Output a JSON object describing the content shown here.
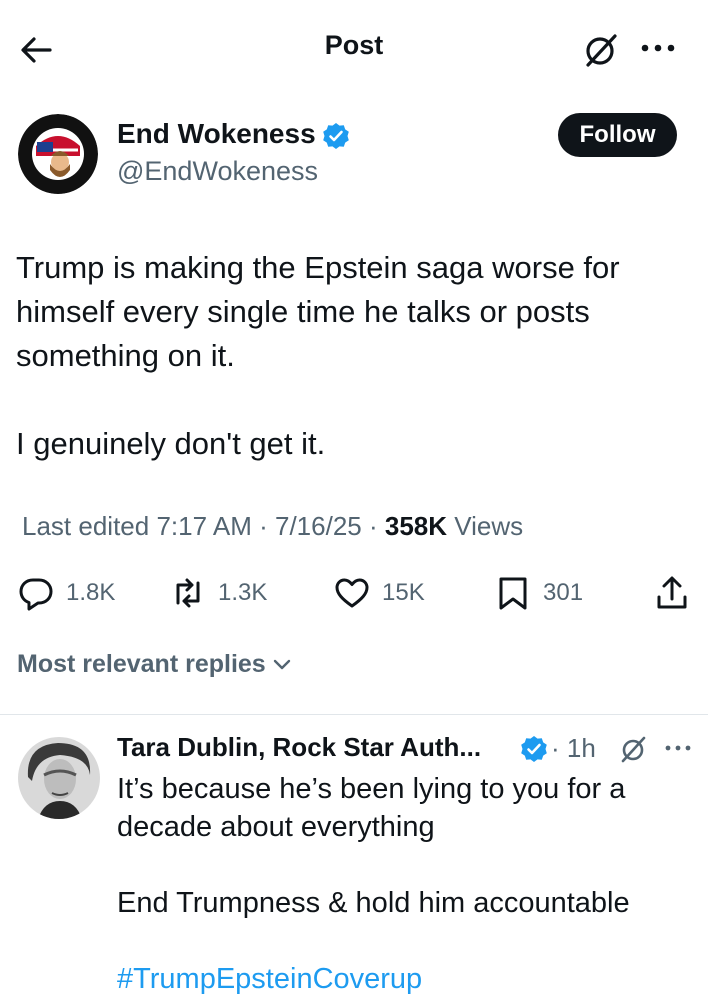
{
  "header": {
    "title": "Post",
    "icons": [
      "back-arrow-icon",
      "grok-icon",
      "more-icon"
    ]
  },
  "post": {
    "author_name": "End Wokeness",
    "author_handle": "@EndWokeness",
    "follow_label": "Follow",
    "verified": true,
    "text": [
      "Trump is making the Epstein saga worse for himself every single time he talks or posts something on it.",
      "I genuinely don't get it."
    ],
    "meta": {
      "edited_label": "Last edited",
      "time": "7:17 AM",
      "separator": "·",
      "date": "7/16/25",
      "views_count": "358K",
      "views_label": "Views"
    },
    "actions": {
      "replies": "1.8K",
      "reposts": "1.3K",
      "likes": "15K",
      "bookmarks": "301"
    }
  },
  "replies_header": {
    "label": "Most relevant replies"
  },
  "reply": {
    "author_name": "Tara Dublin, Rock Star Auth...",
    "verified": true,
    "time": "· 1h",
    "lines": [
      "It’s because he’s been lying to you for a decade about everything",
      "End Trumpness & hold him accountable"
    ],
    "hashtag": "#TrumpEpsteinCoverup"
  },
  "colors": {
    "text": "#0f1419",
    "secondary": "#536471",
    "link": "#1d9bf0",
    "verified_badge": "#1d9bf0",
    "follow_button": "#0f1419"
  }
}
